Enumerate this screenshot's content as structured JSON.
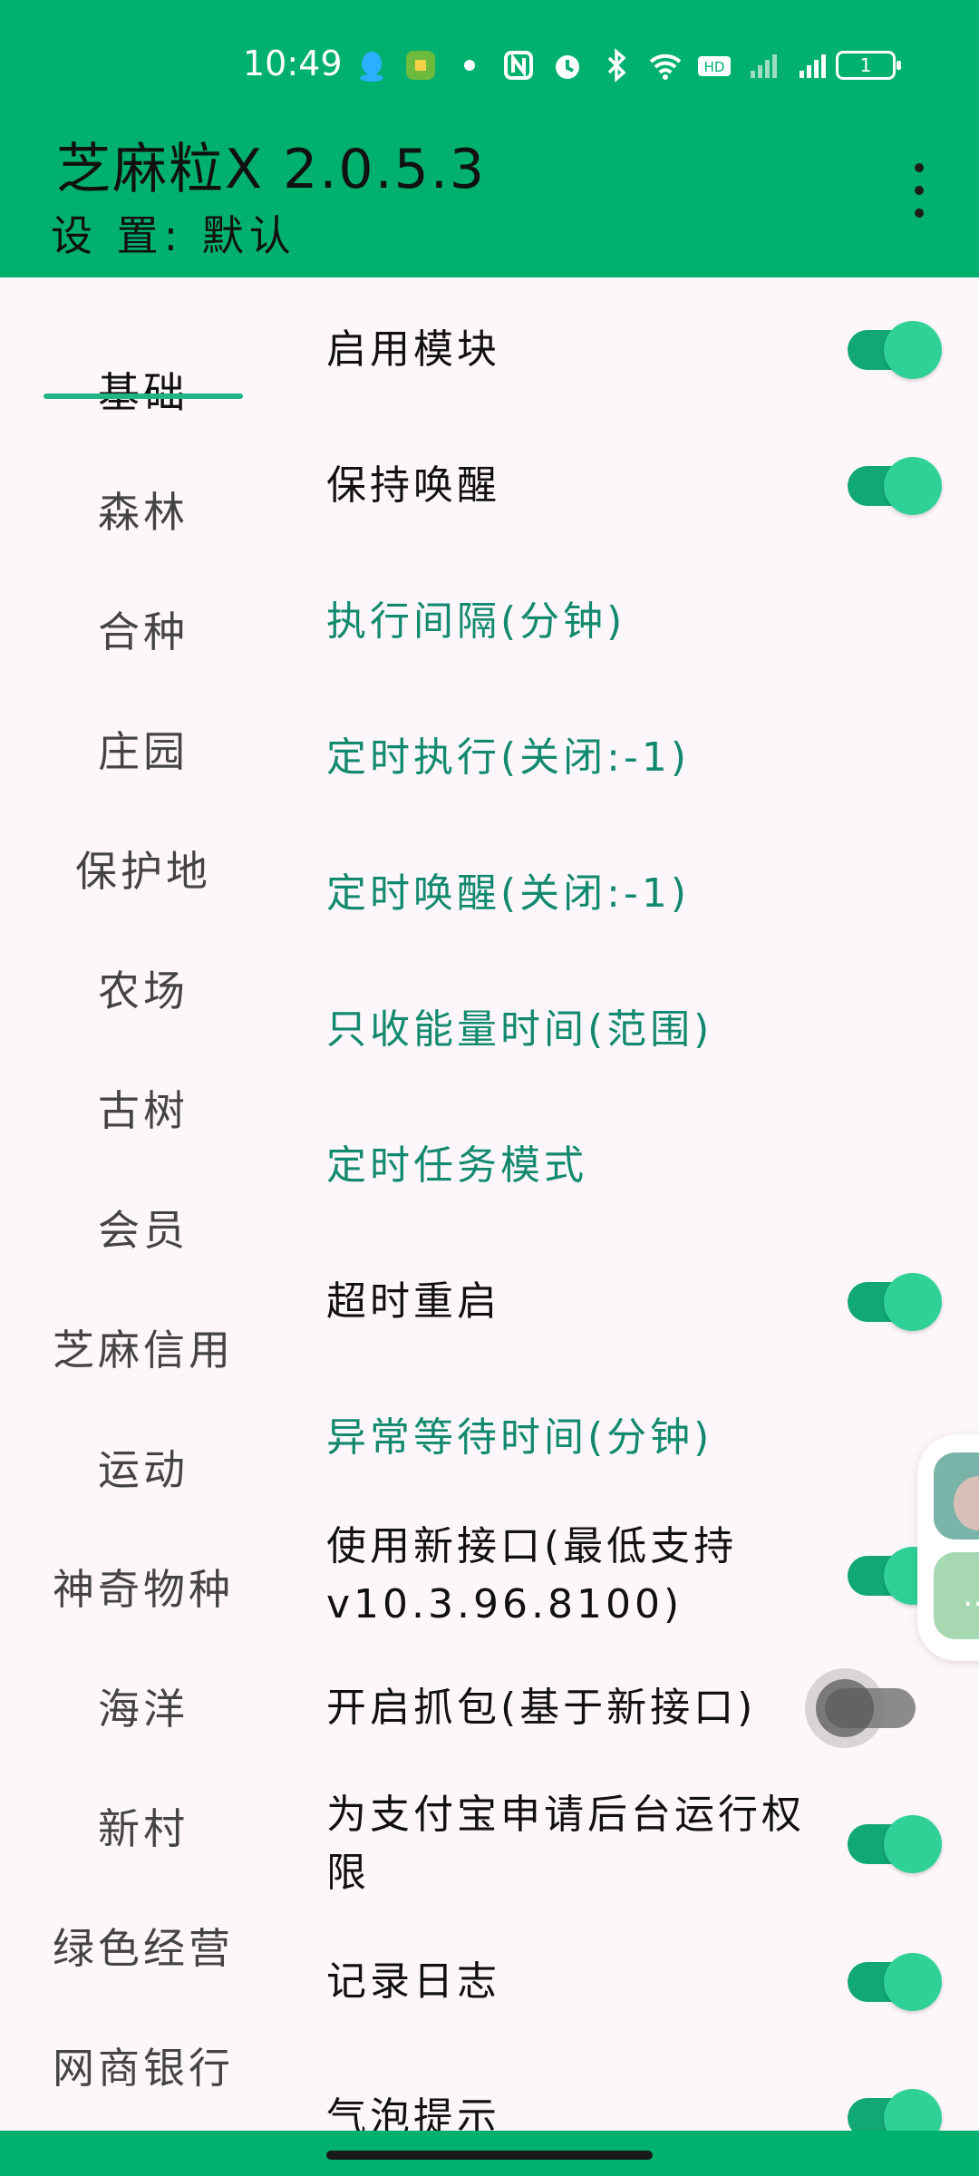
{
  "status_bar": {
    "time": "10:49",
    "icons": [
      "qq-icon",
      "app-notify-icon",
      "dot-icon",
      "nfc-icon",
      "alarm-icon",
      "bluetooth-icon",
      "wifi-icon",
      "hd2-icon",
      "signal-sim1-icon",
      "4g-signal-icon"
    ],
    "battery": "1"
  },
  "app_bar": {
    "title": "芝麻粒X 2.0.5.3",
    "subtitle": "设 置: 默认"
  },
  "sidebar": {
    "items": [
      {
        "label": "基础",
        "active": true
      },
      {
        "label": "森林"
      },
      {
        "label": "合种"
      },
      {
        "label": "庄园"
      },
      {
        "label": "保护地"
      },
      {
        "label": "农场"
      },
      {
        "label": "古树"
      },
      {
        "label": "会员"
      },
      {
        "label": "芝麻信用"
      },
      {
        "label": "运动"
      },
      {
        "label": "神奇物种"
      },
      {
        "label": "海洋"
      },
      {
        "label": "新村"
      },
      {
        "label": "绿色经营"
      },
      {
        "label": "网商银行"
      }
    ]
  },
  "settings": [
    {
      "label": "启用模块",
      "type": "switch",
      "on": true
    },
    {
      "label": "保持唤醒",
      "type": "switch",
      "on": true
    },
    {
      "label": "执行间隔(分钟)",
      "type": "link"
    },
    {
      "label": "定时执行(关闭:-1)",
      "type": "link"
    },
    {
      "label": "定时唤醒(关闭:-1)",
      "type": "link"
    },
    {
      "label": "只收能量时间(范围)",
      "type": "link"
    },
    {
      "label": "定时任务模式",
      "type": "link"
    },
    {
      "label": "超时重启",
      "type": "switch",
      "on": true
    },
    {
      "label": "异常等待时间(分钟)",
      "type": "link"
    },
    {
      "label": "使用新接口(最低支持v10.3.96.8100)",
      "type": "switch",
      "on": true
    },
    {
      "label": "开启抓包(基于新接口)",
      "type": "switch",
      "on": false
    },
    {
      "label": "为支付宝申请后台运行权限",
      "type": "switch",
      "on": true
    },
    {
      "label": "记录日志",
      "type": "switch",
      "on": true
    },
    {
      "label": "气泡提示",
      "type": "switch",
      "on": true
    }
  ],
  "colors": {
    "accent": "#00b06f",
    "switch_on": "#2fd197",
    "link_text": "#138a70",
    "background": "#fdf7fb"
  }
}
